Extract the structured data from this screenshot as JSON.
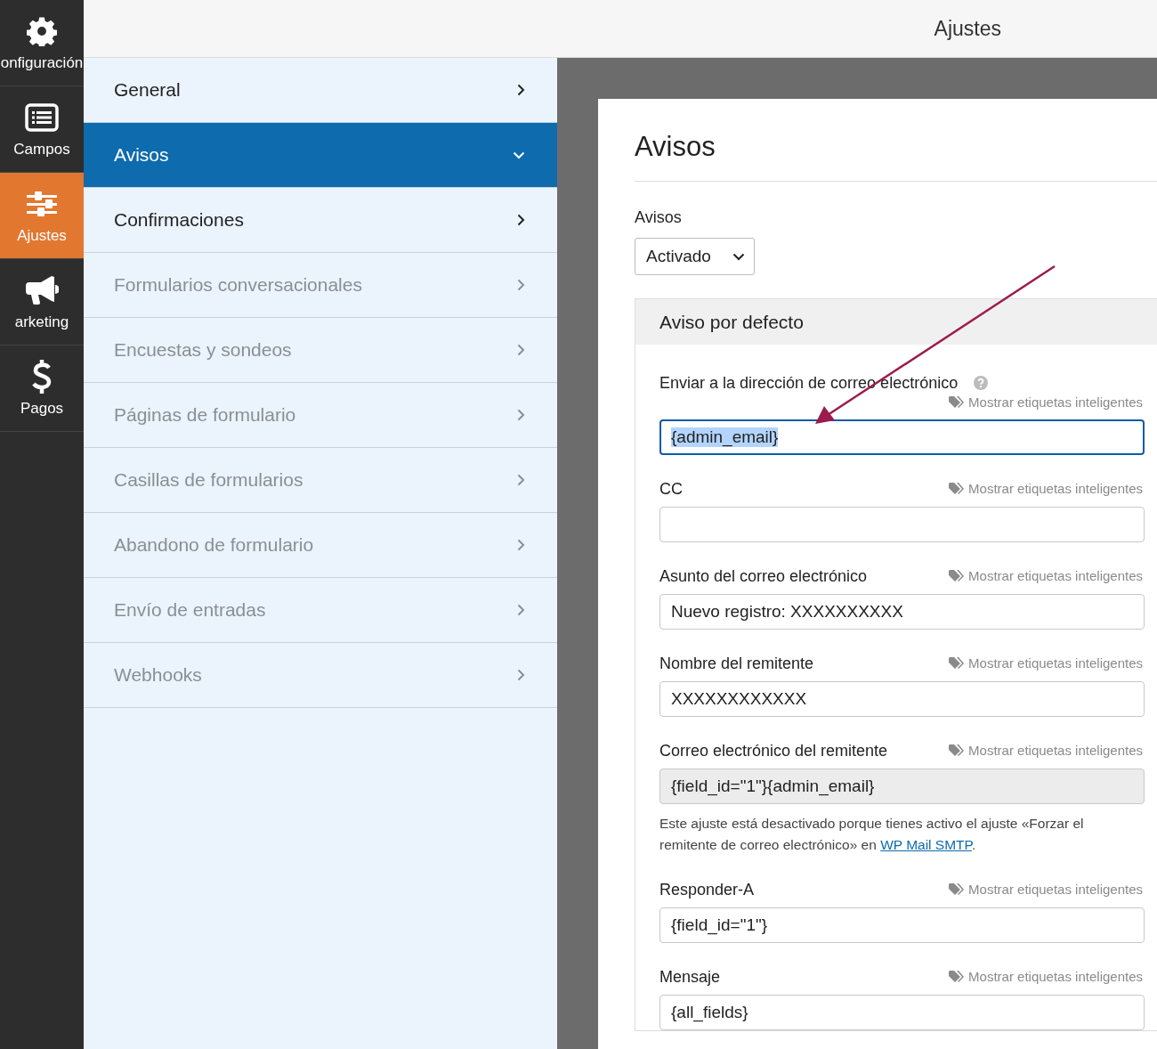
{
  "rail": [
    {
      "kind": "gear",
      "label": "onfiguración",
      "selected": false
    },
    {
      "kind": "list",
      "label": "Campos",
      "selected": false
    },
    {
      "kind": "sliders",
      "label": "Ajustes",
      "selected": true
    },
    {
      "kind": "megaphone",
      "label": "arketing",
      "selected": false
    },
    {
      "kind": "dollar",
      "label": "Pagos",
      "selected": false
    }
  ],
  "top_bar": {
    "title": "Ajustes"
  },
  "sections": [
    {
      "label": "General",
      "selected": false,
      "expanded": false,
      "disabled": false
    },
    {
      "label": "Avisos",
      "selected": true,
      "expanded": true,
      "disabled": false
    },
    {
      "label": "Confirmaciones",
      "selected": false,
      "expanded": false,
      "disabled": false
    },
    {
      "label": "Formularios conversacionales",
      "selected": false,
      "expanded": false,
      "disabled": true
    },
    {
      "label": "Encuestas y sondeos",
      "selected": false,
      "expanded": false,
      "disabled": true
    },
    {
      "label": "Páginas de formulario",
      "selected": false,
      "expanded": false,
      "disabled": true
    },
    {
      "label": "Casillas de formularios",
      "selected": false,
      "expanded": false,
      "disabled": true
    },
    {
      "label": "Abandono de formulario",
      "selected": false,
      "expanded": false,
      "disabled": true
    },
    {
      "label": "Envío de entradas",
      "selected": false,
      "expanded": false,
      "disabled": true
    },
    {
      "label": "Webhooks",
      "selected": false,
      "expanded": false,
      "disabled": true
    }
  ],
  "content": {
    "heading": "Avisos",
    "toggle": {
      "label": "Avisos",
      "value": "Activado"
    },
    "panel": {
      "title": "Aviso por defecto",
      "fields": [
        {
          "label": "Enviar a la dirección de correo electrónico",
          "help": true,
          "smart_tags": "Mostrar etiquetas inteligentes",
          "value": "{admin_email}",
          "focused": true,
          "text_selected": true,
          "disabled": false
        },
        {
          "label": "CC",
          "smart_tags": "Mostrar etiquetas inteligentes",
          "focused": false,
          "disabled": false
        },
        {
          "label": "Asunto del correo electrónico",
          "smart_tags": "Mostrar etiquetas inteligentes",
          "value": "Nuevo registro: XXXXXXXXXX",
          "focused": false,
          "disabled": false
        },
        {
          "label": "Nombre del remitente",
          "smart_tags": "Mostrar etiquetas inteligentes",
          "value": "XXXXXXXXXXXX",
          "focused": false,
          "disabled": false
        },
        {
          "label": "Correo electrónico del remitente",
          "smart_tags": "Mostrar etiquetas inteligentes",
          "value": "{field_id=\"1\"}{admin_email}",
          "focused": false,
          "disabled": true,
          "note": {
            "text": "Este ajuste está desactivado porque tienes activo el ajuste «Forzar el remitente de correo electrónico» en ",
            "link": "WP Mail SMTP",
            "end": "."
          }
        },
        {
          "label": "Responder-A",
          "smart_tags": "Mostrar etiquetas inteligentes",
          "value": "{field_id=\"1\"}",
          "focused": false,
          "disabled": false
        },
        {
          "label": "Mensaje",
          "smart_tags": "Mostrar etiquetas inteligentes",
          "value": "{all_fields}",
          "focused": false,
          "disabled": false
        }
      ]
    }
  }
}
